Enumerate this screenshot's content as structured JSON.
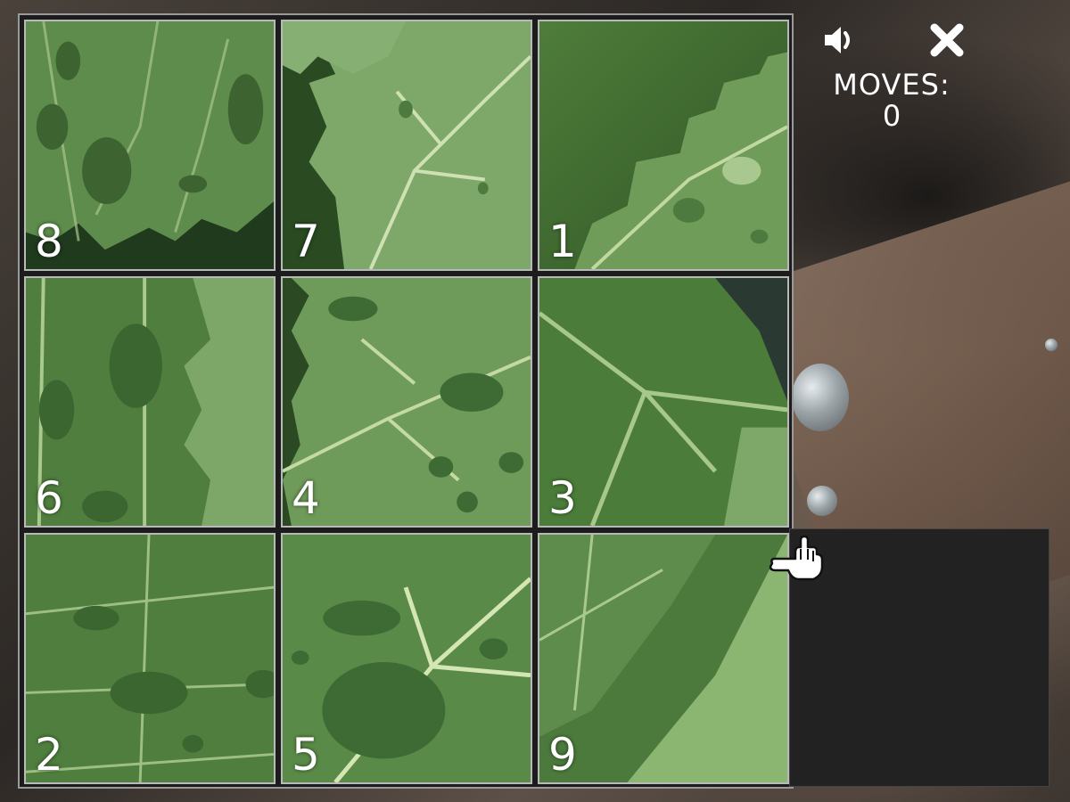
{
  "hud": {
    "moves_label": "MOVES:",
    "moves_value": "0",
    "sound_icon": "speaker-icon",
    "close_icon": "close-icon"
  },
  "tiles": [
    {
      "label": "8"
    },
    {
      "label": "7"
    },
    {
      "label": "1"
    },
    {
      "label": "6"
    },
    {
      "label": "4"
    },
    {
      "label": "3"
    },
    {
      "label": "2"
    },
    {
      "label": "5"
    },
    {
      "label": "9"
    }
  ],
  "colors": {
    "leaf_light": "#7ea86a",
    "leaf_mid": "#5e8c4c",
    "leaf_dark": "#3e6a34",
    "vein": "#c4d9a4",
    "empty": "#222222"
  }
}
